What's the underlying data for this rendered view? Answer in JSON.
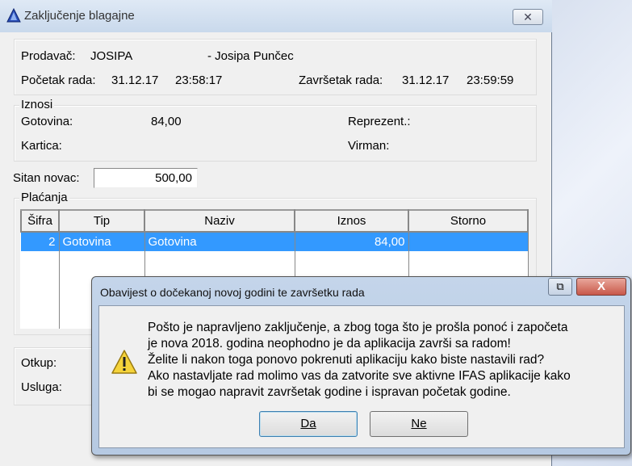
{
  "window": {
    "title": "Zaključenje blagajne",
    "close": "✕"
  },
  "header": {
    "prodavac_label": "Prodavač:",
    "prodavac_code": "JOSIPA",
    "prodavac_name": "- Josipa Punčec",
    "pocetak_label": "Početak rada:",
    "pocetak_date": "31.12.17",
    "pocetak_time": "23:58:17",
    "zavrsetak_label": "Završetak rada:",
    "zavrsetak_date": "31.12.17",
    "zavrsetak_time": "23:59:59"
  },
  "iznosi": {
    "title": "Iznosi",
    "gotovina_label": "Gotovina:",
    "gotovina_value": "84,00",
    "kartica_label": "Kartica:",
    "reprezent_label": "Reprezent.:",
    "virman_label": "Virman:"
  },
  "sitan": {
    "label": "Sitan novac:",
    "value": "500,00"
  },
  "placanja": {
    "title": "Plaćanja",
    "columns": [
      "Šifra",
      "Tip",
      "Naziv",
      "Iznos",
      "Storno"
    ],
    "rows": [
      [
        "2",
        "Gotovina",
        "Gotovina",
        "84,00",
        ""
      ]
    ]
  },
  "bottom": {
    "otkup_label": "Otkup:",
    "usluga_label": "Usluga:"
  },
  "dialog": {
    "title": "Obavijest o dočekanoj novoj godini te završetku rada",
    "lines": [
      "Pošto je napravljeno zaključenje, a zbog toga što je prošla ponoć i započeta",
      "je nova 2018. godina neophodno je da aplikacija završi sa radom!",
      "Želite li nakon toga ponovo pokrenuti aplikaciju kako biste nastavili rad?",
      "Ako nastavljate rad molimo vas da zatvorite sve aktivne IFAS aplikacije kako",
      "bi se mogao napravit završetak godine i ispravan početak godine."
    ],
    "yes": "Da",
    "no": "Ne",
    "close": "X"
  }
}
